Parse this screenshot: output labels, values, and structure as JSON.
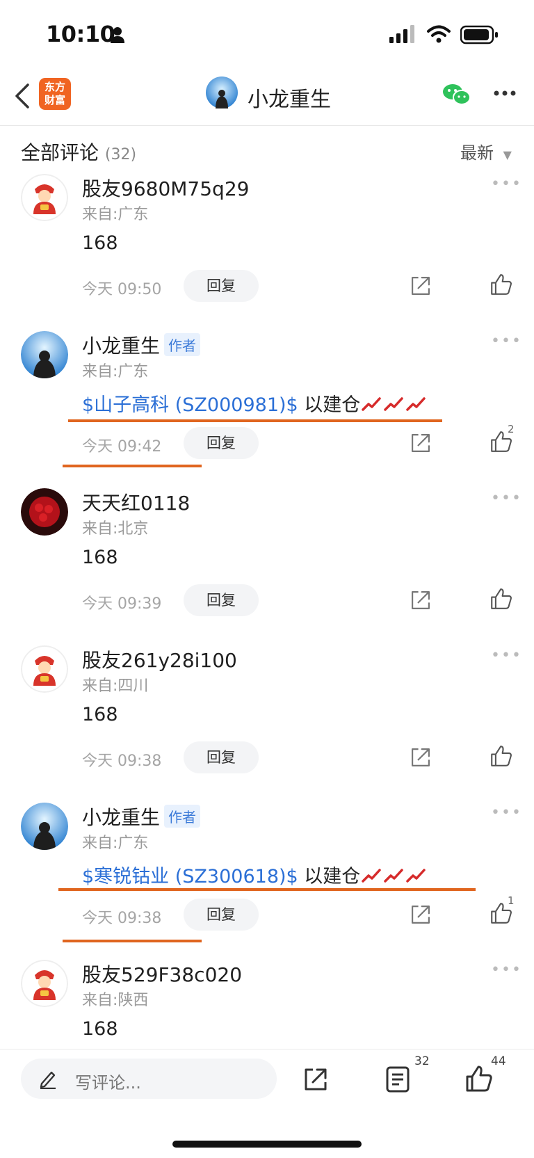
{
  "status_bar": {
    "time": "10:10"
  },
  "nav": {
    "logo_line1": "东方",
    "logo_line2": "财富",
    "title": "小龙重生"
  },
  "comments_header": {
    "label": "全部评论",
    "count": "(32)",
    "sort": "最新"
  },
  "comments": [
    {
      "name": "股友9680M75q29",
      "author": false,
      "location": "来自:广东",
      "content": "168",
      "stock": "",
      "suffix": "",
      "time": "今天 09:50",
      "reply": "回复",
      "likes": "",
      "avatar": "fortune"
    },
    {
      "name": "小龙重生",
      "author": true,
      "author_tag": "作者",
      "location": "来自:广东",
      "content": "",
      "stock": "$山子高科 (SZ000981)$",
      "suffix": " 以建仓",
      "time": "今天 09:42",
      "reply": "回复",
      "likes": "2",
      "avatar": "sky"
    },
    {
      "name": "天天红0118",
      "author": false,
      "location": "来自:北京",
      "content": "168",
      "stock": "",
      "suffix": "",
      "time": "今天 09:39",
      "reply": "回复",
      "likes": "",
      "avatar": "roses"
    },
    {
      "name": "股友261y28i100",
      "author": false,
      "location": "来自:四川",
      "content": "168",
      "stock": "",
      "suffix": "",
      "time": "今天 09:38",
      "reply": "回复",
      "likes": "",
      "avatar": "fortune"
    },
    {
      "name": "小龙重生",
      "author": true,
      "author_tag": "作者",
      "location": "来自:广东",
      "content": "",
      "stock": "$寒锐钴业 (SZ300618)$",
      "suffix": " 以建仓",
      "time": "今天 09:38",
      "reply": "回复",
      "likes": "1",
      "avatar": "sky"
    },
    {
      "name": "股友529F38c020",
      "author": false,
      "location": "来自:陕西",
      "content": "168",
      "stock": "",
      "suffix": "",
      "time": "",
      "reply": "",
      "likes": "",
      "avatar": "fortune"
    }
  ],
  "bottom_bar": {
    "placeholder": "写评论...",
    "comment_count": "32",
    "like_count": "44"
  },
  "colors": {
    "brand": "#f06422",
    "link": "#2b6fd6",
    "highlight": "#e0651f"
  },
  "icons": [
    "back-icon",
    "wechat-icon",
    "more-icon",
    "share-icon",
    "like-icon",
    "pencil-icon",
    "list-icon",
    "trend-emoji-icon"
  ]
}
